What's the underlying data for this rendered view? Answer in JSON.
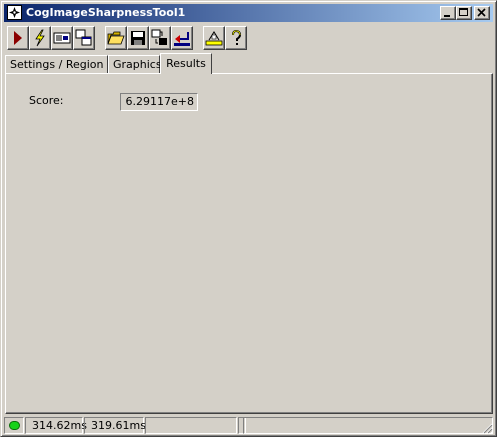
{
  "window": {
    "title": "CogImageSharpnessTool1"
  },
  "caption_buttons": [
    {
      "name": "minimize-button",
      "icon": "minimize-icon"
    },
    {
      "name": "maximize-button",
      "icon": "maximize-icon"
    },
    {
      "name": "close-button",
      "icon": "close-icon"
    }
  ],
  "toolbar": {
    "buttons": [
      {
        "name": "run-button",
        "icon": "run-triangle-icon"
      },
      {
        "name": "electric-run-button",
        "icon": "lightning-icon"
      },
      {
        "name": "show-terminal-button",
        "icon": "terminal-icon"
      },
      {
        "name": "toggle-view-button",
        "icon": "window-swap-icon"
      },
      {
        "name": "open-button",
        "icon": "folder-open-icon"
      },
      {
        "name": "save-button",
        "icon": "floppy-disk-icon"
      },
      {
        "name": "data-transfer-button",
        "icon": "data-transfer-icon"
      },
      {
        "name": "reset-button",
        "icon": "reset-arrow-icon"
      },
      {
        "name": "display-button",
        "icon": "display-icon"
      },
      {
        "name": "help-button",
        "icon": "question-mark-icon"
      }
    ]
  },
  "tabs": [
    {
      "label": "Settings / Region",
      "active": false
    },
    {
      "label": "Graphics",
      "active": false
    },
    {
      "label": "Results",
      "active": true
    }
  ],
  "results": {
    "score_label": "Score:",
    "score_value": "6.29117e+8"
  },
  "statusbar": {
    "run_status_color": "#17d21a",
    "cells": [
      {
        "text": ""
      },
      {
        "text": "314.62ms"
      },
      {
        "text": "319.61ms"
      },
      {
        "text": ""
      },
      {
        "text": ""
      },
      {
        "text": ""
      }
    ]
  },
  "colors": {
    "face": "#d4d0c8",
    "title_gradient_start": "#0a246a",
    "title_gradient_end": "#a6caf0"
  }
}
